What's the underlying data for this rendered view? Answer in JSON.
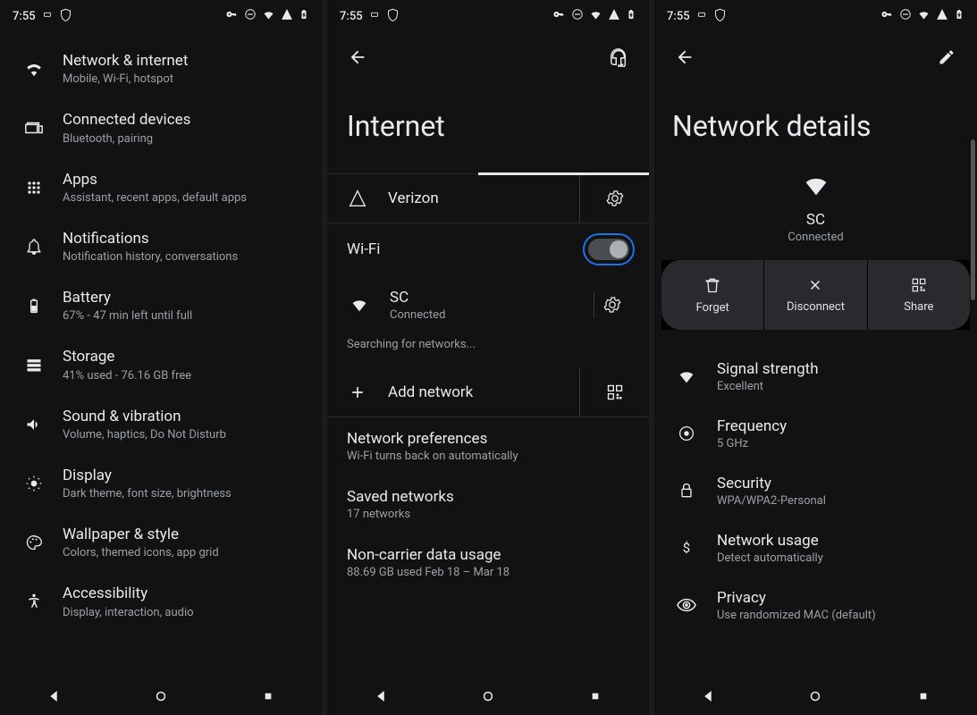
{
  "status": {
    "time": "7:55"
  },
  "screen1": {
    "items": [
      {
        "title": "Network & internet",
        "sub": "Mobile, Wi-Fi, hotspot"
      },
      {
        "title": "Connected devices",
        "sub": "Bluetooth, pairing"
      },
      {
        "title": "Apps",
        "sub": "Assistant, recent apps, default apps"
      },
      {
        "title": "Notifications",
        "sub": "Notification history, conversations"
      },
      {
        "title": "Battery",
        "sub": "67% - 47 min left until full"
      },
      {
        "title": "Storage",
        "sub": "41% used - 76.16 GB free"
      },
      {
        "title": "Sound & vibration",
        "sub": "Volume, haptics, Do Not Disturb"
      },
      {
        "title": "Display",
        "sub": "Dark theme, font size, brightness"
      },
      {
        "title": "Wallpaper & style",
        "sub": "Colors, themed icons, app grid"
      },
      {
        "title": "Accessibility",
        "sub": "Display, interaction, audio"
      }
    ]
  },
  "screen2": {
    "title": "Internet",
    "carrier": "Verizon",
    "wifi_label": "Wi-Fi",
    "network_name": "SC",
    "network_status": "Connected",
    "searching": "Searching for networks...",
    "add_network": "Add network",
    "prefs": {
      "title": "Network preferences",
      "sub": "Wi-Fi turns back on automatically"
    },
    "saved": {
      "title": "Saved networks",
      "sub": "17 networks"
    },
    "usage": {
      "title": "Non-carrier data usage",
      "sub": "88.69 GB used Feb 18 – Mar 18"
    }
  },
  "screen3": {
    "title": "Network details",
    "ssid": "SC",
    "status": "Connected",
    "actions": {
      "forget": "Forget",
      "disconnect": "Disconnect",
      "share": "Share"
    },
    "details": [
      {
        "title": "Signal strength",
        "sub": "Excellent"
      },
      {
        "title": "Frequency",
        "sub": "5 GHz"
      },
      {
        "title": "Security",
        "sub": "WPA/WPA2-Personal"
      },
      {
        "title": "Network usage",
        "sub": "Detect automatically"
      },
      {
        "title": "Privacy",
        "sub": "Use randomized MAC (default)"
      }
    ]
  }
}
